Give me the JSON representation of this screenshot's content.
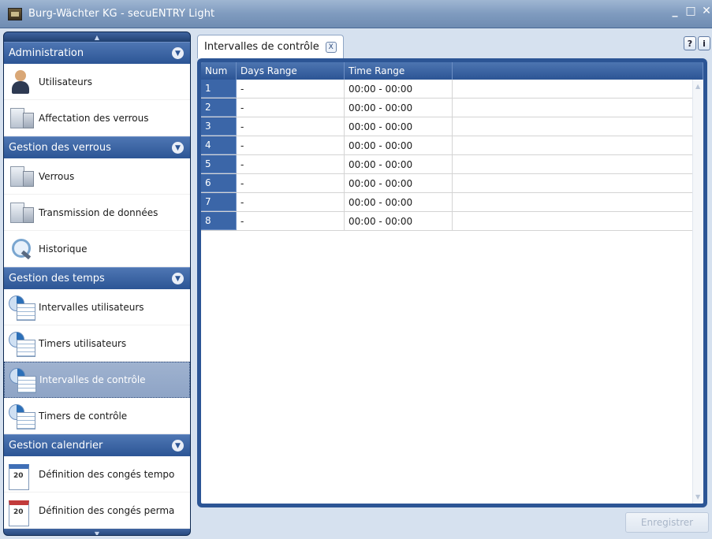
{
  "window": {
    "title": "Burg-Wächter KG - secuENTRY Light",
    "controls": [
      "_",
      "□",
      "✕"
    ]
  },
  "sidebar": {
    "sections": [
      {
        "label": "Administration",
        "items": [
          {
            "label": "Utilisateurs",
            "icon": "user-icon"
          },
          {
            "label": "Affectation des verrous",
            "icon": "lock-assign-icon"
          }
        ]
      },
      {
        "label": "Gestion des verrous",
        "items": [
          {
            "label": "Verrous",
            "icon": "lock-icon"
          },
          {
            "label": "Transmission de données",
            "icon": "data-transmission-icon"
          },
          {
            "label": "Historique",
            "icon": "history-lens-icon"
          }
        ]
      },
      {
        "label": "Gestion des temps",
        "items": [
          {
            "label": "Intervalles utilisateurs",
            "icon": "clock-calendar-icon"
          },
          {
            "label": "Timers utilisateurs",
            "icon": "clock-user-icon"
          },
          {
            "label": "Intervalles de contrôle",
            "icon": "clock-calendar-icon",
            "selected": true
          },
          {
            "label": "Timers de contrôle",
            "icon": "clock-lock-icon"
          }
        ]
      },
      {
        "label": "Gestion calendrier",
        "items": [
          {
            "label": "Définition des congés tempo",
            "icon": "calendar-icon"
          },
          {
            "label": "Définition des congés perma",
            "icon": "calendar-red-icon"
          }
        ]
      }
    ]
  },
  "tab": {
    "label": "Intervalles de contrôle",
    "close": "X"
  },
  "help": {
    "question": "?",
    "info": "i"
  },
  "grid": {
    "columns": [
      "Num",
      "Days Range",
      "Time Range"
    ],
    "rows": [
      {
        "num": "1",
        "days": "-",
        "time": "00:00 - 00:00"
      },
      {
        "num": "2",
        "days": "-",
        "time": "00:00 - 00:00"
      },
      {
        "num": "3",
        "days": "-",
        "time": "00:00 - 00:00"
      },
      {
        "num": "4",
        "days": "-",
        "time": "00:00 - 00:00"
      },
      {
        "num": "5",
        "days": "-",
        "time": "00:00 - 00:00"
      },
      {
        "num": "6",
        "days": "-",
        "time": "00:00 - 00:00"
      },
      {
        "num": "7",
        "days": "-",
        "time": "00:00 - 00:00"
      },
      {
        "num": "8",
        "days": "-",
        "time": "00:00 - 00:00"
      }
    ]
  },
  "save_label": "Enregistrer",
  "colors": {
    "accent": "#2c5595",
    "selected": "#8ea4c6"
  }
}
